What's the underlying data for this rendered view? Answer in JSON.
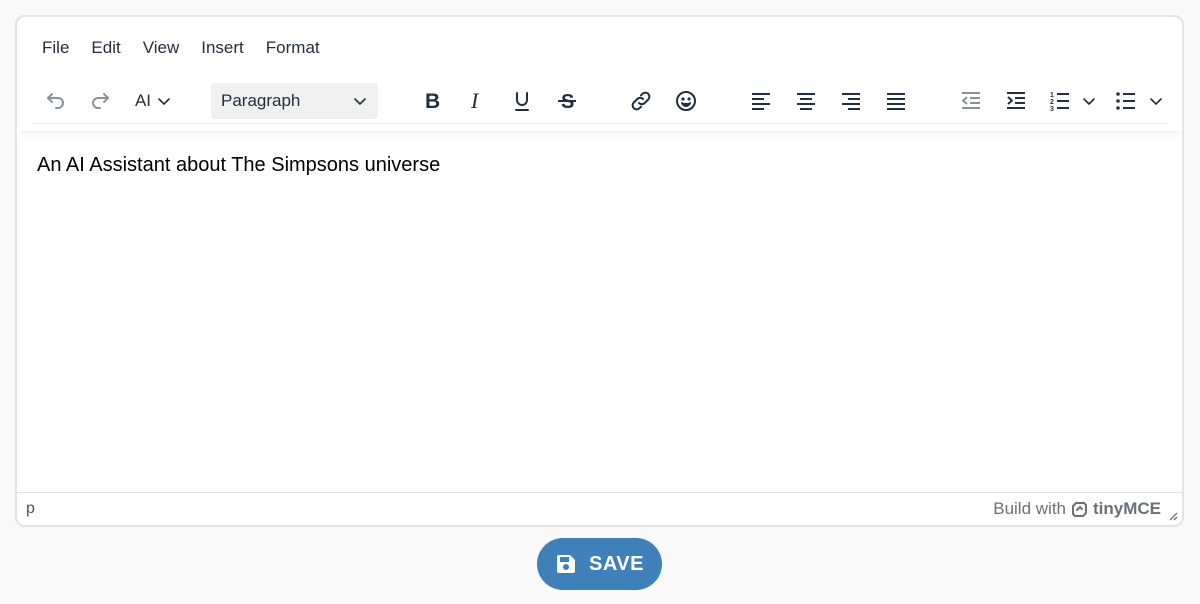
{
  "menubar": {
    "items": [
      "File",
      "Edit",
      "View",
      "Insert",
      "Format"
    ]
  },
  "toolbar": {
    "ai_label": "AI",
    "block_format": "Paragraph",
    "icons": {
      "undo": "undo-icon",
      "redo": "redo-icon",
      "bold": "bold-icon",
      "italic": "italic-icon",
      "underline": "underline-icon",
      "strikethrough": "strikethrough-icon",
      "link": "link-icon",
      "emoji": "emoji-icon",
      "align_left": "align-left-icon",
      "align_center": "align-center-icon",
      "align_right": "align-right-icon",
      "align_justify": "align-justify-icon",
      "outdent": "outdent-icon",
      "indent": "indent-icon",
      "numbered_list": "numbered-list-icon",
      "bullet_list": "bullet-list-icon"
    }
  },
  "content": {
    "text": "An AI Assistant about The Simpsons universe"
  },
  "statusbar": {
    "path": "p",
    "branding_prefix": "Build with",
    "branding_logo": "tinyMCE"
  },
  "save_button": {
    "label": "SAVE",
    "color": "#4080b8"
  }
}
